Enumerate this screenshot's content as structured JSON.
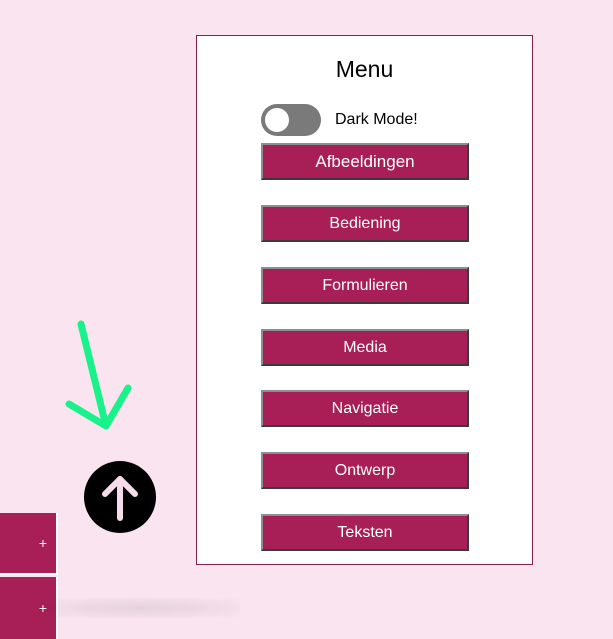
{
  "menu": {
    "title": "Menu",
    "dark_mode_label": "Dark Mode!",
    "dark_mode_on": false,
    "items": [
      {
        "label": "Afbeeldingen"
      },
      {
        "label": "Bediening"
      },
      {
        "label": "Formulieren"
      },
      {
        "label": "Media"
      },
      {
        "label": "Navigatie"
      },
      {
        "label": "Ontwerp"
      },
      {
        "label": "Teksten"
      }
    ]
  },
  "side_tiles": [
    {
      "label": "+"
    },
    {
      "label": "+"
    }
  ],
  "icons": {
    "back_to_top": "arrow-up-icon",
    "annotation": "green-arrow-icon"
  },
  "colors": {
    "background": "#f9e4ef",
    "accent": "#a81f57",
    "annotation": "#19f28a"
  }
}
